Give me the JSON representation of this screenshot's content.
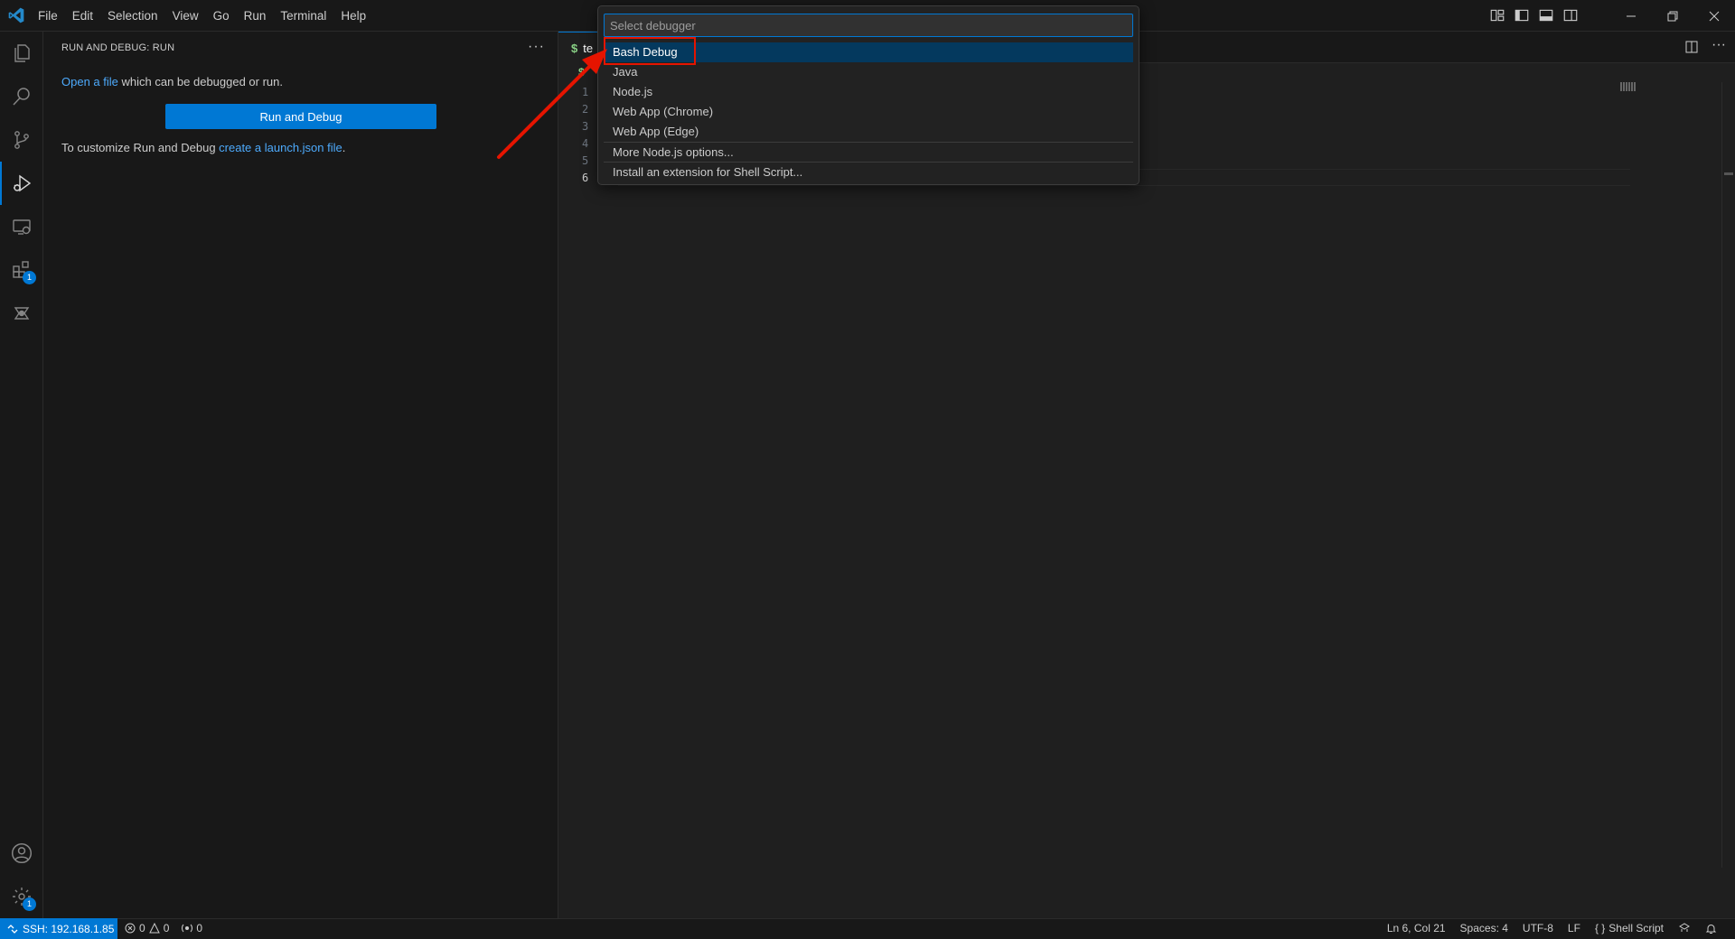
{
  "menu": [
    "File",
    "Edit",
    "Selection",
    "View",
    "Go",
    "Run",
    "Terminal",
    "Help"
  ],
  "sidebar": {
    "title": "RUN AND DEBUG: RUN",
    "more": "···",
    "intro_link": "Open a file",
    "intro_text": " which can be debugged or run.",
    "run_button": "Run and Debug",
    "customize_text": "To customize Run and Debug ",
    "customize_link": "create a launch.json file",
    "customize_end": "."
  },
  "activity": {
    "extensions_badge": "1",
    "settings_badge": "1"
  },
  "editor": {
    "tab_label": "te",
    "breadcrumb": "$",
    "line_numbers": [
      "1",
      "2",
      "3",
      "4",
      "5",
      "6"
    ]
  },
  "quickpick": {
    "placeholder": "Select debugger",
    "items": [
      "Bash Debug",
      "Java",
      "Node.js",
      "Web App (Chrome)",
      "Web App (Edge)",
      "More Node.js options...",
      "Install an extension for Shell Script..."
    ],
    "selected": "Bash Debug"
  },
  "statusbar": {
    "remote": "SSH: 192.168.1.85",
    "errors": "0",
    "warnings": "0",
    "ports": "0",
    "position": "Ln 6, Col 21",
    "spaces": "Spaces: 4",
    "encoding": "UTF-8",
    "eol": "LF",
    "language": "Shell Script"
  },
  "colors": {
    "accent": "#0078d4",
    "annotation": "#e51400",
    "link": "#4daafc"
  }
}
